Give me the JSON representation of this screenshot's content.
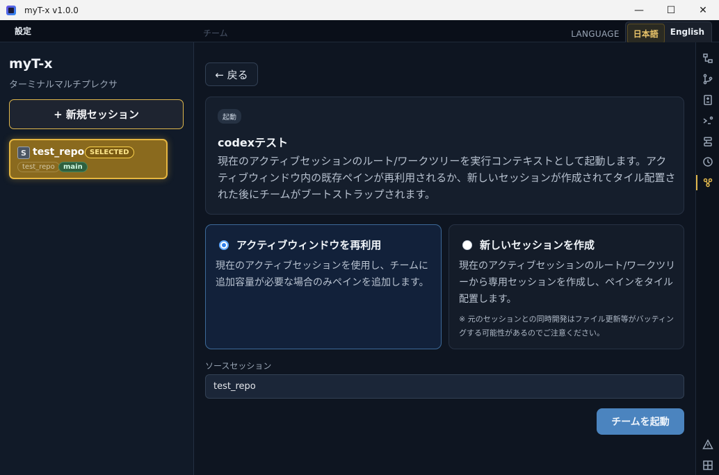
{
  "window": {
    "title": "myT-x v1.0.0",
    "minimize": "—",
    "maximize": "☐",
    "close": "✕"
  },
  "menubar": {
    "settings": "設定",
    "ghost_title": "チーム",
    "language_label": "LANGUAGE",
    "languages": [
      {
        "label": "日本語",
        "active": true
      },
      {
        "label": "English",
        "active": false
      }
    ]
  },
  "sidebar": {
    "brand": "myT-x",
    "subtitle": "ターミナルマルチプレクサ",
    "new_session": "+ 新規セッション",
    "session": {
      "badge": "S",
      "name": "test_repo",
      "selected": "SELECTED",
      "repo_tag": "test_repo",
      "branch_tag": "main"
    }
  },
  "main": {
    "back": "← 戻る",
    "card": {
      "pill": "起動",
      "title": "codexテスト",
      "description": "現在のアクティブセッションのルート/ワークツリーを実行コンテキストとして起動します。アクティブウィンドウ内の既存ペインが再利用されるか、新しいセッションが作成されてタイル配置された後にチームがブートストラップされます。"
    },
    "options": [
      {
        "title": "アクティブウィンドウを再利用",
        "description": "現在のアクティブセッションを使用し、チームに追加容量が必要な場合のみペインを追加します。",
        "selected": true
      },
      {
        "title": "新しいセッションを作成",
        "description": "現在のアクティブセッションのルート/ワークツリーから専用セッションを作成し、ペインをタイル配置します。",
        "note": "※ 元のセッションとの同時開発はファイル更新等がバッティングする可能性があるのでご注意ください。",
        "selected": false
      }
    ],
    "source_label": "ソースセッション",
    "source_value": "test_repo",
    "launch": "チームを起動"
  },
  "rail": {
    "icons": [
      "file-tree-icon",
      "git-branch-icon",
      "diff-icon",
      "terminal-icon",
      "layout-icon",
      "history-icon",
      "team-icon",
      "warning-icon",
      "grid-icon"
    ],
    "active": "team-icon",
    "accent": "#e2b84c"
  }
}
